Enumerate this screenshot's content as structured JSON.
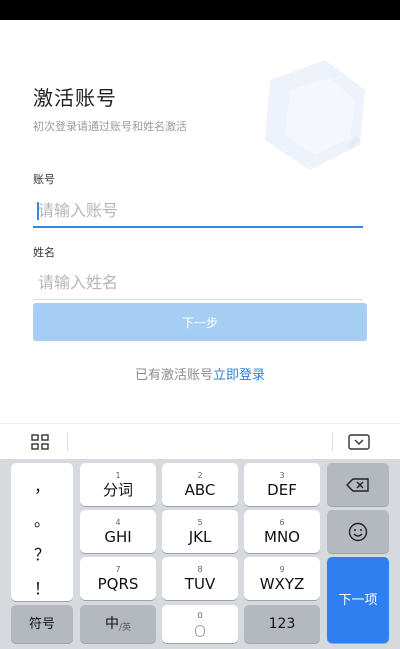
{
  "page": {
    "title": "激活账号",
    "subtitle": "初次登录请通过账号和姓名激活",
    "account_label": "账号",
    "account_placeholder": "请输入账号",
    "name_label": "姓名",
    "name_placeholder": "请输入姓名",
    "next_button": "下一步",
    "existing_prefix": "已有激活账号",
    "login_link": "立即登录",
    "colors": {
      "accent": "#2d7fd4",
      "button_disabled": "#a6cef5",
      "keyboard_action": "#2f7ff0"
    }
  },
  "keyboard": {
    "toolbar": {
      "left_icon": "grid-icon",
      "right_icon": "keyboard-hide-icon"
    },
    "punctuation": [
      "，",
      "。",
      "？",
      "！"
    ],
    "keys": {
      "k1": {
        "num": "1",
        "label": "分词"
      },
      "k2": {
        "num": "2",
        "label": "ABC"
      },
      "k3": {
        "num": "3",
        "label": "DEF"
      },
      "k4": {
        "num": "4",
        "label": "GHI"
      },
      "k5": {
        "num": "5",
        "label": "JKL"
      },
      "k6": {
        "num": "6",
        "label": "MNO"
      },
      "k7": {
        "num": "7",
        "label": "PQRS"
      },
      "k8": {
        "num": "8",
        "label": "TUV"
      },
      "k9": {
        "num": "9",
        "label": "WXYZ"
      },
      "k0": {
        "num": "0"
      }
    },
    "symbols": "符号",
    "lang_main": "中",
    "lang_sub": "/英",
    "num_mode": "123",
    "next_item": "下一项",
    "backspace_icon": "backspace-icon",
    "emoji_icon": "emoji-icon"
  }
}
